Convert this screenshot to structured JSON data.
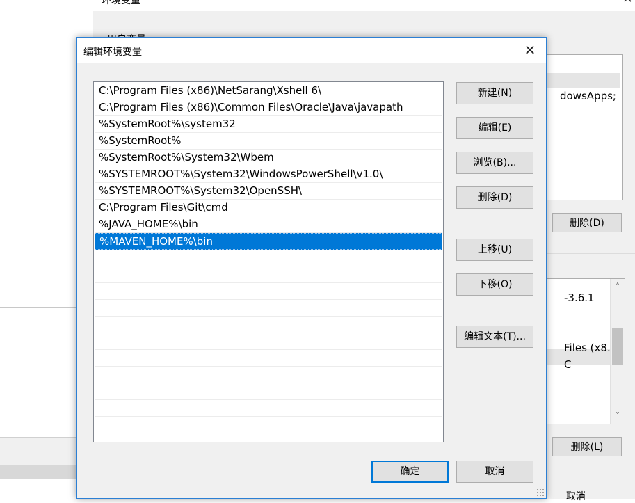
{
  "parent_window": {
    "title": "环境变量",
    "close_glyph": "✕",
    "user_section_label": "用户变量",
    "user_list_partial_text": "dowsApps;",
    "user_delete_label": "删除(D)",
    "system_list_partial": [
      "-3.6.1",
      "Files (x8...",
      "C"
    ],
    "system_delete_label": "删除(L)",
    "bottom_partial_label": "取消",
    "scroll_up_glyph": "˄",
    "scroll_down_glyph": "˅"
  },
  "dialog": {
    "title": "编辑环境变量",
    "close_glyph": "✕",
    "paths": [
      "C:\\Program Files (x86)\\NetSarang\\Xshell 6\\",
      "C:\\Program Files (x86)\\Common Files\\Oracle\\Java\\javapath",
      "%SystemRoot%\\system32",
      "%SystemRoot%",
      "%SystemRoot%\\System32\\Wbem",
      "%SYSTEMROOT%\\System32\\WindowsPowerShell\\v1.0\\",
      "%SYSTEMROOT%\\System32\\OpenSSH\\",
      "C:\\Program Files\\Git\\cmd",
      "%JAVA_HOME%\\bin",
      "%MAVEN_HOME%\\bin"
    ],
    "selected_path": "%MAVEN_HOME%\\bin",
    "buttons": {
      "new": "新建(N)",
      "edit": "编辑(E)",
      "browse": "浏览(B)...",
      "delete": "删除(D)",
      "move_up": "上移(U)",
      "move_down": "下移(O)",
      "edit_text": "编辑文本(T)...",
      "ok": "确定",
      "cancel": "取消"
    }
  },
  "colors": {
    "accent": "#0078d7",
    "button_bg": "#e1e1e1",
    "window_bg": "#f0f0f0"
  }
}
